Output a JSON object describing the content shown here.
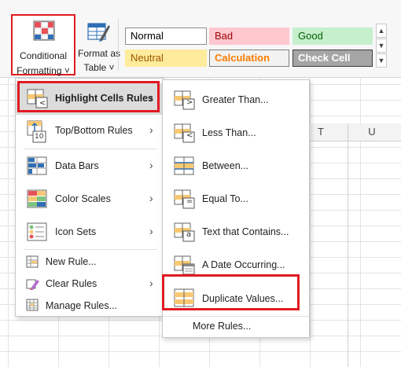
{
  "ribbon": {
    "conditional_formatting": {
      "line1": "Conditional",
      "line2": "Formatting",
      "dropdown": "˅"
    },
    "format_as_table": {
      "line1": "Format as",
      "line2": "Table",
      "dropdown": "˅"
    },
    "styles": [
      {
        "label": "Normal",
        "bg": "#ffffff",
        "fg": "#000000",
        "border": "#8c8c8c"
      },
      {
        "label": "Bad",
        "bg": "#ffc7ce",
        "fg": "#9c0006",
        "border": "#ffc7ce"
      },
      {
        "label": "Good",
        "bg": "#c6efce",
        "fg": "#006100",
        "border": "#c6efce"
      },
      {
        "label": "Neutral",
        "bg": "#ffeb9c",
        "fg": "#9c5700",
        "border": "#ffeb9c"
      },
      {
        "label": "Calculation",
        "bg": "#f2f2f2",
        "fg": "#fa7d00",
        "border": "#7f7f7f"
      },
      {
        "label": "Check Cell",
        "bg": "#a5a5a5",
        "fg": "#ffffff",
        "border": "#3f3f3f"
      }
    ],
    "scroll": {
      "up": "▲",
      "down": "▼",
      "more": "▼"
    }
  },
  "grid": {
    "col_t": "T",
    "col_u": "U"
  },
  "main_menu": {
    "items": [
      {
        "label": "Highlight Cells Rules",
        "arrow": "›",
        "icon": "highlight-cells-icon"
      },
      {
        "label": "Top/Bottom Rules",
        "arrow": "›",
        "icon": "top-bottom-icon"
      },
      {
        "label": "Data Bars",
        "arrow": "›",
        "icon": "data-bars-icon"
      },
      {
        "label": "Color Scales",
        "arrow": "›",
        "icon": "color-scales-icon"
      },
      {
        "label": "Icon Sets",
        "arrow": "›",
        "icon": "icon-sets-icon"
      }
    ],
    "small_items": [
      {
        "label": "New Rule...",
        "icon": "new-rule-icon"
      },
      {
        "label": "Clear Rules",
        "arrow": "›",
        "icon": "clear-rules-icon"
      },
      {
        "label": "Manage Rules...",
        "icon": "manage-rules-icon"
      }
    ]
  },
  "sub_menu": {
    "items": [
      {
        "label": "Greater Than...",
        "glyph": ">"
      },
      {
        "label": "Less Than...",
        "glyph": "<"
      },
      {
        "label": "Between...",
        "glyph": ""
      },
      {
        "label": "Equal To...",
        "glyph": "="
      },
      {
        "label": "Text that Contains...",
        "glyph": "a"
      },
      {
        "label": "A Date Occurring...",
        "glyph": ""
      },
      {
        "label": "Duplicate Values...",
        "glyph": ""
      }
    ],
    "more_rules": "More Rules..."
  },
  "top_bottom_glyph": "10",
  "accent": {
    "highlight_red": "#e01a22",
    "cell_orange": "#f7c873",
    "cell_blue": "#2f6fb5"
  }
}
